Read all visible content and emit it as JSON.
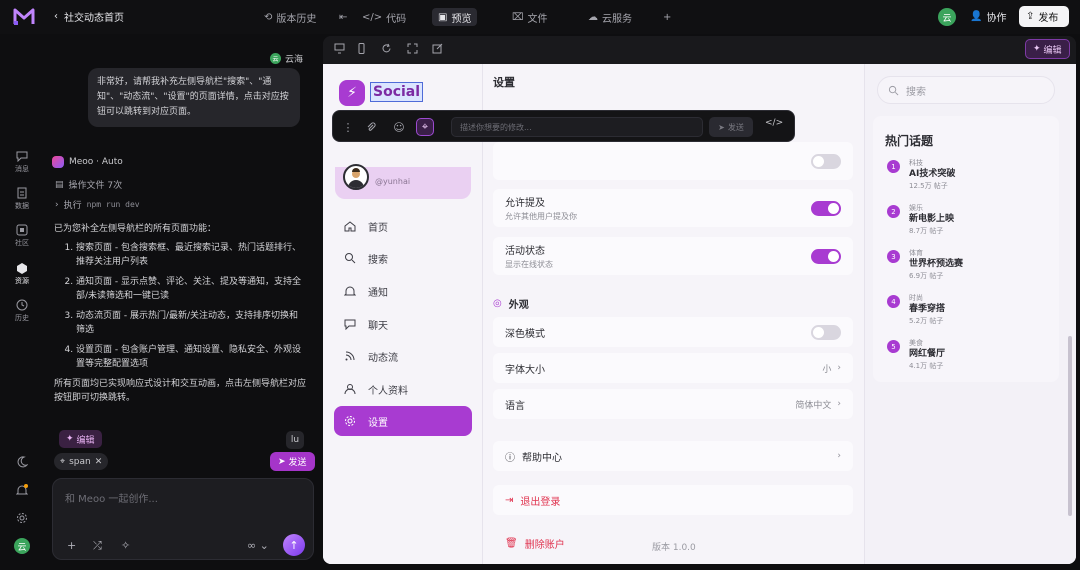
{
  "topbar": {
    "back_label": "社交动态首页",
    "history_label": "版本历史",
    "code_label": "代码",
    "preview_label": "预览",
    "files_label": "文件",
    "cloud_label": "云服务",
    "avatar_initial": "云",
    "collab_label": "协作",
    "publish_label": "发布"
  },
  "rail": {
    "items": [
      {
        "label": "消息"
      },
      {
        "label": "数据"
      },
      {
        "label": "社区"
      },
      {
        "label": "资源"
      },
      {
        "label": "历史"
      }
    ]
  },
  "chat": {
    "user_name": "云海",
    "user_initial": "云",
    "user_message": "非常好，请帮我补充左侧导航栏\"搜索\"、\"通知\"、\"动态流\"、\"设置\"的页面详情，点击对应按钮可以跳转到对应页面。",
    "assistant_name": "Meoo · Auto",
    "op_files": "操作文件 7次",
    "op_exec_label": "执行",
    "op_exec_cmd": "npm run dev",
    "intro": "已为您补全左侧导航栏的所有页面功能：",
    "items": [
      "搜索页面 - 包含搜索框、最近搜索记录、热门话题排行、推荐关注用户列表",
      "通知页面 - 显示点赞、评论、关注、提及等通知，支持全部/未读筛选和一键已读",
      "动态流页面 - 展示热门/最新/关注动态，支持排序切换和筛选",
      "设置页面 - 包含账户管理、通知设置、隐私安全、外观设置等完整配置选项"
    ],
    "summary": "所有页面均已实现响应式设计和交互动画，点击左侧导航栏对应按钮即可切换跳转。",
    "edit_chip": "编辑",
    "file_chip": "span",
    "side_chip": "lu",
    "send_chip": "发送",
    "composer_placeholder": "和 Meoo 一起创作..."
  },
  "preview": {
    "edit_button": "编辑",
    "app_name": "Social",
    "profile_handle": "@yunhai",
    "nav": [
      {
        "label": "首页",
        "icon": "home-icon"
      },
      {
        "label": "搜索",
        "icon": "search-icon"
      },
      {
        "label": "通知",
        "icon": "bell-icon"
      },
      {
        "label": "聊天",
        "icon": "chat-icon"
      },
      {
        "label": "动态流",
        "icon": "rss-icon"
      },
      {
        "label": "个人资料",
        "icon": "user-icon"
      },
      {
        "label": "设置",
        "icon": "gear-icon"
      }
    ],
    "settings": {
      "title": "设置",
      "mention_label": "允许提及",
      "mention_sub": "允许其他用户提及你",
      "status_label": "活动状态",
      "status_sub": "显示在线状态",
      "appearance_heading": "外观",
      "dark_label": "深色模式",
      "font_label": "字体大小",
      "font_value": "小",
      "lang_label": "语言",
      "lang_value": "简体中文",
      "help_label": "帮助中心",
      "logout_label": "退出登录",
      "delete_label": "删除账户",
      "version": "版本 1.0.0"
    },
    "float_bar": {
      "placeholder": "描述你想要的修改...",
      "send_label": "发送",
      "code_label": "</>"
    },
    "right": {
      "search_placeholder": "搜索",
      "trend_title": "热门话题",
      "trends": [
        {
          "num": "1",
          "cat": "科技",
          "name": "AI技术突破",
          "count": "12.5万 帖子"
        },
        {
          "num": "2",
          "cat": "娱乐",
          "name": "新电影上映",
          "count": "8.7万 帖子"
        },
        {
          "num": "3",
          "cat": "体育",
          "name": "世界杯预选赛",
          "count": "6.9万 帖子"
        },
        {
          "num": "4",
          "cat": "时尚",
          "name": "春季穿搭",
          "count": "5.2万 帖子"
        },
        {
          "num": "5",
          "cat": "美食",
          "name": "网红餐厅",
          "count": "4.1万 帖子"
        }
      ]
    }
  },
  "colors": {
    "accent": "#a83bd1",
    "background": "#0e0e10",
    "danger": "#e0334f"
  }
}
